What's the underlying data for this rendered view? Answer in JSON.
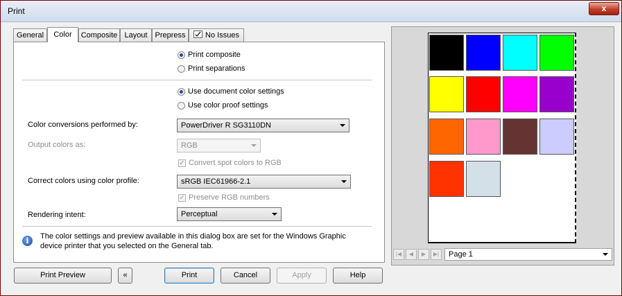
{
  "window": {
    "title": "Print",
    "close_label": "x"
  },
  "tabs": [
    {
      "label": "General"
    },
    {
      "label": "Color"
    },
    {
      "label": "Composite"
    },
    {
      "label": "Layout"
    },
    {
      "label": "Prepress"
    },
    {
      "label": "No Issues"
    }
  ],
  "color_tab": {
    "print_composite": "Print composite",
    "print_separations": "Print separations",
    "use_document_settings": "Use document color settings",
    "use_proof_settings": "Use color proof settings",
    "conversions_label": "Color conversions performed by:",
    "conversions_value": "PowerDriver R SG3110DN",
    "output_colors_label": "Output colors as:",
    "output_colors_value": "RGB",
    "convert_spot_label": "Convert spot colors to RGB",
    "correct_colors_label": "Correct colors using color profile:",
    "profile_value": "sRGB IEC61966-2.1",
    "preserve_rgb_label": "Preserve RGB numbers",
    "rendering_intent_label": "Rendering intent:",
    "rendering_intent_value": "Perceptual",
    "info_text_1": "The color settings and preview available in this dialog box are set for the Windows Graphic",
    "info_text_2": "device printer that you selected on the General tab."
  },
  "buttons": {
    "print_preview": "Print Preview",
    "collapse": "«",
    "print": "Print",
    "cancel": "Cancel",
    "apply": "Apply",
    "help": "Help"
  },
  "preview": {
    "page_select": "Page 1",
    "swatches": [
      "#000000",
      "#0000ff",
      "#00ffff",
      "#00ff00",
      "#ffff00",
      "#ff0000",
      "#ff00ff",
      "#9900cc",
      "#ff6600",
      "#ff99cc",
      "#663333",
      "#ccccff",
      "#ff3300",
      "#d4e0e8"
    ]
  }
}
